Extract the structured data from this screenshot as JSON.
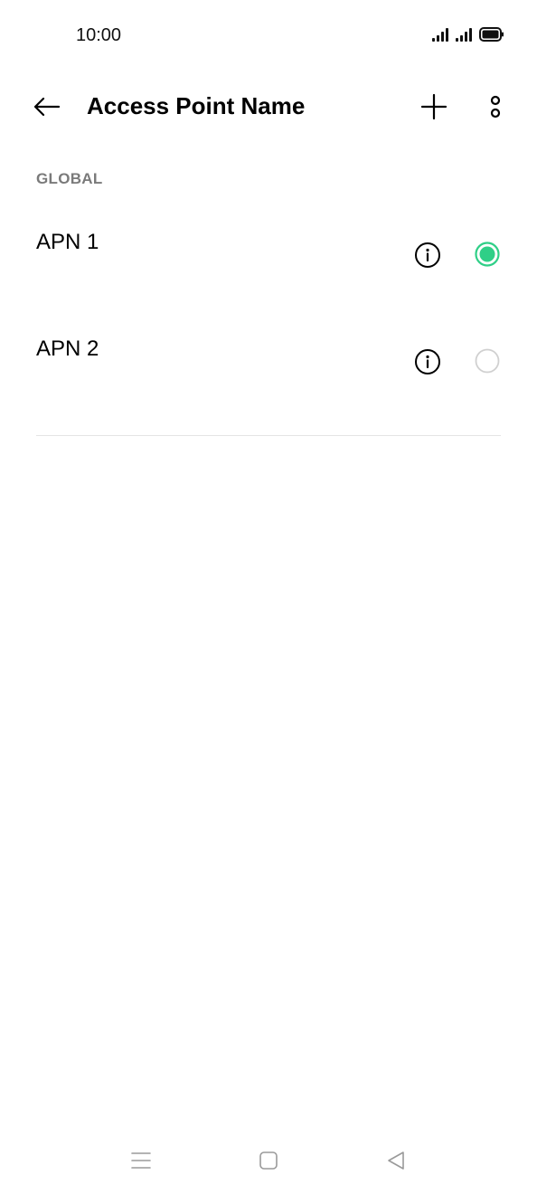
{
  "status_bar": {
    "time": "10:00"
  },
  "app_bar": {
    "title": "Access Point Name",
    "back_icon": "arrow-left-icon",
    "add_icon": "plus-icon",
    "more_icon": "more-vertical-icon"
  },
  "section": {
    "header": "GLOBAL"
  },
  "apn_items": [
    {
      "name": "APN 1",
      "selected": true
    },
    {
      "name": "APN 2",
      "selected": false
    }
  ],
  "colors": {
    "accent": "#2fcf87",
    "radio_off": "#d0d0d0",
    "section_header": "#7a7a7a",
    "divider": "#e4e4e4"
  },
  "nav_bar": {
    "menu_icon": "menu-icon",
    "home_icon": "home-square-icon",
    "back_icon": "back-triangle-icon"
  }
}
